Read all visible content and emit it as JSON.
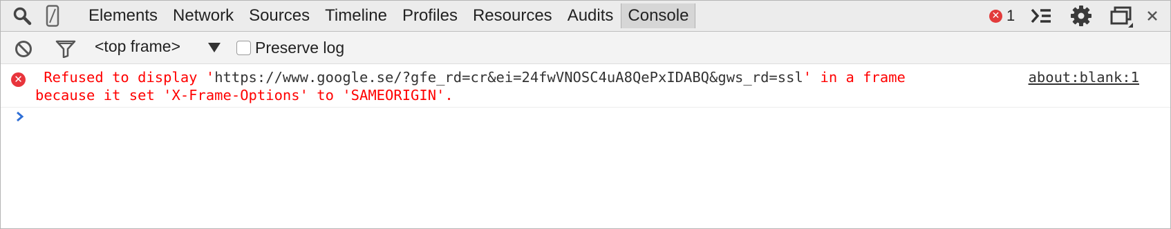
{
  "tabbar": {
    "tabs": [
      {
        "label": "Elements"
      },
      {
        "label": "Network"
      },
      {
        "label": "Sources"
      },
      {
        "label": "Timeline"
      },
      {
        "label": "Profiles"
      },
      {
        "label": "Resources"
      },
      {
        "label": "Audits"
      },
      {
        "label": "Console",
        "selected": true
      }
    ],
    "error_count": "1",
    "icons": [
      "search-icon",
      "device-mode-icon",
      "error-icon",
      "console-drawer-icon",
      "settings-gear-icon",
      "dock-side-icon",
      "close-icon"
    ]
  },
  "toolbar": {
    "frame_selector": "<top frame>",
    "preserve_log_label": "Preserve log",
    "preserve_log_checked": false,
    "icons": [
      "clear-console-icon",
      "filter-icon",
      "dropdown-arrow-icon"
    ]
  },
  "console": {
    "messages": [
      {
        "level": "error",
        "text_before": " Refused to display '",
        "url": "https://www.google.se/?gfe_rd=cr&ei=24fwVNOSC4uA8QePxIDABQ&gws_rd=ssl",
        "text_after": "' in a frame\nbecause it set 'X-Frame-Options' to 'SAMEORIGIN'.",
        "source": "about:blank:1"
      }
    ],
    "prompt_icon": "prompt-chevron-icon"
  },
  "colors": {
    "error": "#ff0000",
    "error_icon": "#e8353c",
    "prompt": "#2f6fd6",
    "tabbar_bg": "#ececec",
    "selected_tab_bg": "#d6d6d6"
  }
}
